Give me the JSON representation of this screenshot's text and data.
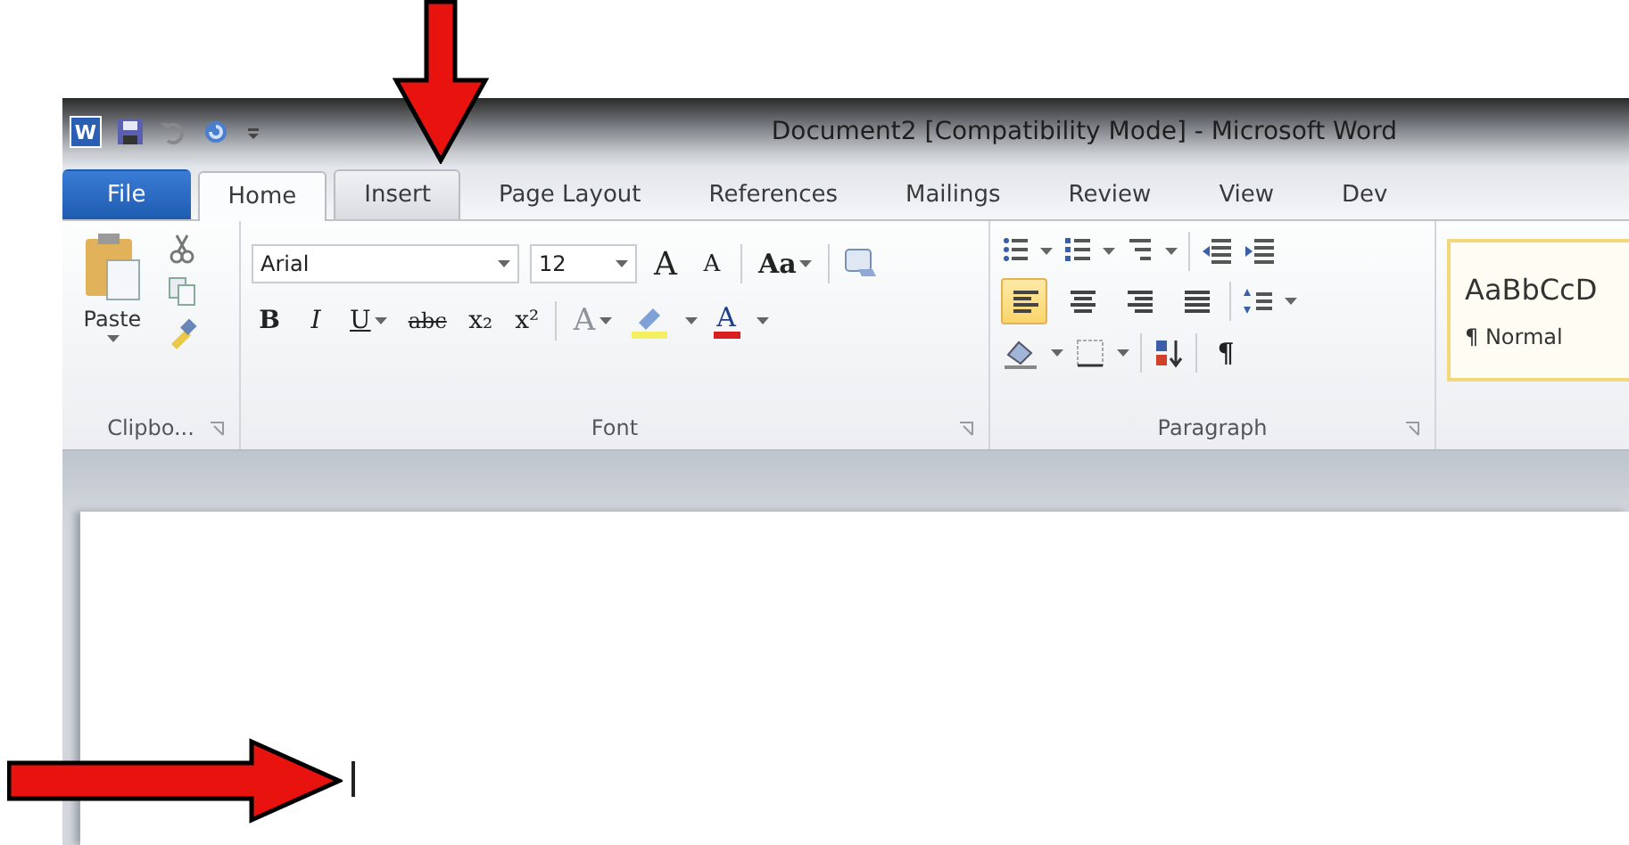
{
  "window": {
    "title": "Document2 [Compatibility Mode]  -  Microsoft Word",
    "app_letter": "W"
  },
  "tabs": [
    {
      "label": "File",
      "kind": "file",
      "selected": false,
      "highlighted": false
    },
    {
      "label": "Home",
      "kind": "tab",
      "selected": true,
      "highlighted": false
    },
    {
      "label": "Insert",
      "kind": "tab",
      "selected": false,
      "highlighted": true
    },
    {
      "label": "Page Layout",
      "kind": "tab",
      "selected": false,
      "highlighted": false
    },
    {
      "label": "References",
      "kind": "tab",
      "selected": false,
      "highlighted": false
    },
    {
      "label": "Mailings",
      "kind": "tab",
      "selected": false,
      "highlighted": false
    },
    {
      "label": "Review",
      "kind": "tab",
      "selected": false,
      "highlighted": false
    },
    {
      "label": "View",
      "kind": "tab",
      "selected": false,
      "highlighted": false
    },
    {
      "label": "Dev",
      "kind": "tab",
      "selected": false,
      "highlighted": false
    }
  ],
  "clipboard": {
    "label": "Clipbo...",
    "paste": "Paste"
  },
  "font": {
    "label": "Font",
    "name": "Arial",
    "size": "12",
    "change_case": "Aa",
    "row2": [
      {
        "glyph": "B",
        "kind": "bold"
      },
      {
        "glyph": "I",
        "kind": "italic"
      },
      {
        "glyph": "U",
        "kind": "underline"
      },
      {
        "glyph": "abc",
        "kind": "strike"
      },
      {
        "glyph": "x₂",
        "kind": "plain"
      },
      {
        "glyph": "x²",
        "kind": "plain"
      }
    ],
    "grow": "A",
    "shrink": "A",
    "effects": "A",
    "color_glyph": "A"
  },
  "paragraph": {
    "label": "Paragraph",
    "alignment": [
      {
        "kind": "left",
        "selected": true
      },
      {
        "kind": "center",
        "selected": false
      },
      {
        "kind": "right",
        "selected": false
      },
      {
        "kind": "justify",
        "selected": false
      }
    ],
    "marks": "¶"
  },
  "styles": {
    "preview": "AaBbCcD",
    "name": "¶ Normal"
  }
}
